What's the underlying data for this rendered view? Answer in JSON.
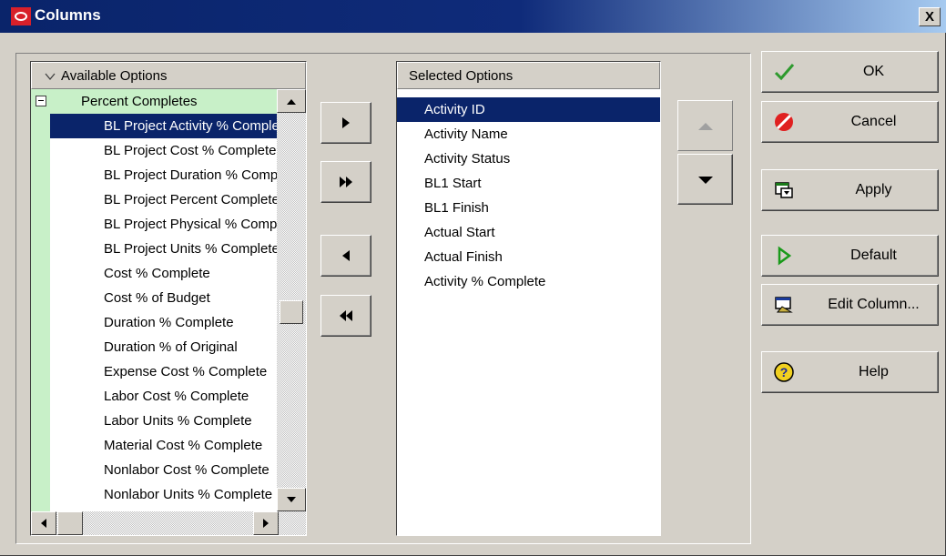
{
  "window": {
    "title": "Columns",
    "close_glyph": "X"
  },
  "available": {
    "header": "Available Options",
    "group": {
      "expander": "−",
      "label": "Percent Completes"
    },
    "items": [
      "BL Project Activity % Complete",
      "BL Project Cost % Complete",
      "BL Project Duration % Complete",
      "BL Project Percent Complete",
      "BL Project Physical % Complete",
      "BL Project Units % Complete",
      "Cost % Complete",
      "Cost % of Budget",
      "Duration % Complete",
      "Duration % of Original",
      "Expense Cost % Complete",
      "Labor Cost % Complete",
      "Labor Units % Complete",
      "Material Cost % Complete",
      "Nonlabor Cost % Complete",
      "Nonlabor Units % Complete"
    ],
    "selected_index": 0
  },
  "selected": {
    "header": "Selected Options",
    "items": [
      "Activity ID",
      "Activity Name",
      "Activity Status",
      "BL1 Start",
      "BL1 Finish",
      "Actual Start",
      "Actual Finish",
      "Activity % Complete"
    ],
    "selected_index": 0
  },
  "buttons": {
    "ok": "OK",
    "cancel": "Cancel",
    "apply": "Apply",
    "default": "Default",
    "edit_column": "Edit Column...",
    "help": "Help"
  },
  "icons": {
    "ok": "checkmark-icon",
    "cancel": "no-entry-icon",
    "apply": "apply-icon",
    "default": "play-triangle-icon",
    "edit_column": "edit-column-icon",
    "help": "help-icon"
  },
  "colors": {
    "title_bar": "#0a246a",
    "selection": "#0a246a",
    "group_band": "#c8f0c8",
    "dialog_bg": "#d4d0c8"
  }
}
